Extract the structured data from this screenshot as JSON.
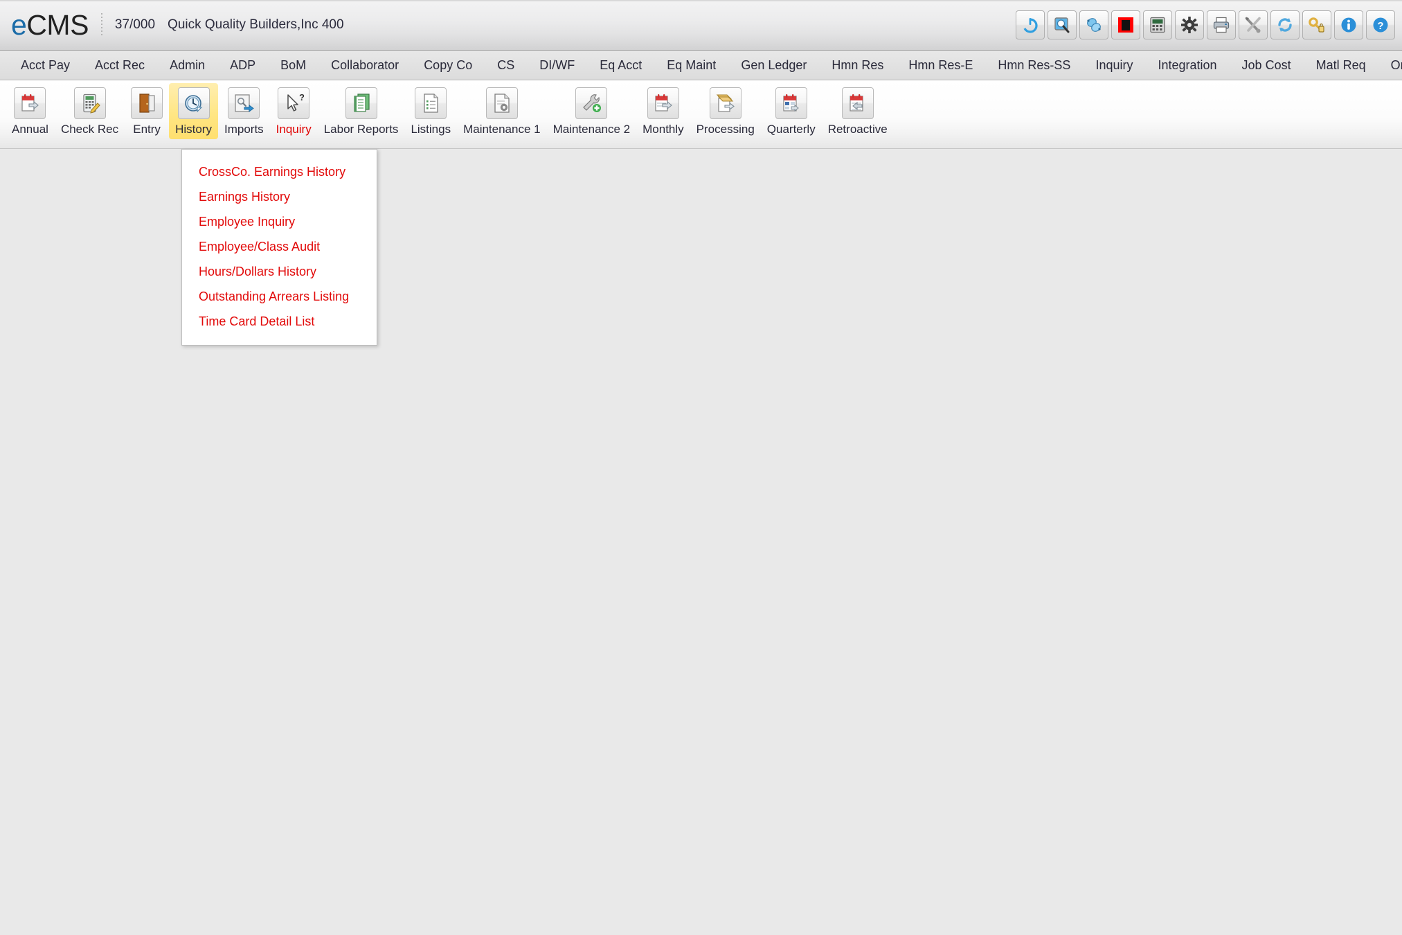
{
  "header": {
    "brand_e": "e",
    "brand_rest": "CMS",
    "company_code": "37/000",
    "company_name": "Quick Quality Builders,Inc 400",
    "icons": [
      {
        "name": "power-icon",
        "title": "Power / Sign Off"
      },
      {
        "name": "search-icon",
        "title": "Search"
      },
      {
        "name": "link-icon",
        "title": "Links"
      },
      {
        "name": "stop-icon",
        "title": "Stop"
      },
      {
        "name": "calculator-icon",
        "title": "Calculator"
      },
      {
        "name": "gear-icon",
        "title": "Settings"
      },
      {
        "name": "printer-icon",
        "title": "Print"
      },
      {
        "name": "tools-icon",
        "title": "Tools"
      },
      {
        "name": "refresh-icon",
        "title": "Refresh"
      },
      {
        "name": "key-icon",
        "title": "Security"
      },
      {
        "name": "info-icon",
        "title": "Information"
      },
      {
        "name": "help-icon",
        "title": "Help"
      }
    ]
  },
  "menubar": {
    "items": [
      {
        "label": "Acct Pay"
      },
      {
        "label": "Acct Rec"
      },
      {
        "label": "Admin"
      },
      {
        "label": "ADP"
      },
      {
        "label": "BoM"
      },
      {
        "label": "Collaborator"
      },
      {
        "label": "Copy Co"
      },
      {
        "label": "CS"
      },
      {
        "label": "DI/WF"
      },
      {
        "label": "Eq Acct"
      },
      {
        "label": "Eq Maint"
      },
      {
        "label": "Gen Ledger"
      },
      {
        "label": "Hmn Res"
      },
      {
        "label": "Hmn Res-E"
      },
      {
        "label": "Hmn Res-SS"
      },
      {
        "label": "Inquiry"
      },
      {
        "label": "Integration"
      },
      {
        "label": "Job Cost"
      },
      {
        "label": "Matl Req"
      },
      {
        "label": "Ord P"
      }
    ]
  },
  "ribbon": {
    "buttons": [
      {
        "label": "Annual",
        "icon": "calendar-arrow-right-icon",
        "state": "normal"
      },
      {
        "label": "Check Rec",
        "icon": "calculator-pencil-icon",
        "state": "normal"
      },
      {
        "label": "Entry",
        "icon": "door-open-icon",
        "state": "normal"
      },
      {
        "label": "History",
        "icon": "clock-page-icon",
        "state": "active"
      },
      {
        "label": "Imports",
        "icon": "import-arrow-icon",
        "state": "normal"
      },
      {
        "label": "Inquiry",
        "icon": "cursor-question-icon",
        "state": "hover"
      },
      {
        "label": "Labor Reports",
        "icon": "report-stack-icon",
        "state": "normal"
      },
      {
        "label": "Listings",
        "icon": "list-document-icon",
        "state": "normal"
      },
      {
        "label": "Maintenance 1",
        "icon": "document-gear-icon",
        "state": "normal"
      },
      {
        "label": "Maintenance 2",
        "icon": "wrench-plus-icon",
        "state": "normal"
      },
      {
        "label": "Monthly",
        "icon": "calendar-arrow-right-icon",
        "state": "normal"
      },
      {
        "label": "Processing",
        "icon": "gold-arrow-page-icon",
        "state": "normal"
      },
      {
        "label": "Quarterly",
        "icon": "calendar-quarter-icon",
        "state": "normal"
      },
      {
        "label": "Retroactive",
        "icon": "calendar-arrow-left-icon",
        "state": "normal"
      }
    ]
  },
  "dropdown": {
    "open_for": "History",
    "items": [
      {
        "label": "CrossCo. Earnings History"
      },
      {
        "label": "Earnings History"
      },
      {
        "label": "Employee Inquiry"
      },
      {
        "label": "Employee/Class Audit"
      },
      {
        "label": "Hours/Dollars History"
      },
      {
        "label": "Outstanding Arrears Listing"
      },
      {
        "label": "Time Card Detail List"
      }
    ]
  },
  "colors": {
    "menu_text": "#2a2a3a",
    "accent_red": "#e20a0a",
    "highlight_yellow": "#ffe684",
    "brand_blue": "#1b6ca8",
    "content_bg": "#e9e9e9"
  }
}
